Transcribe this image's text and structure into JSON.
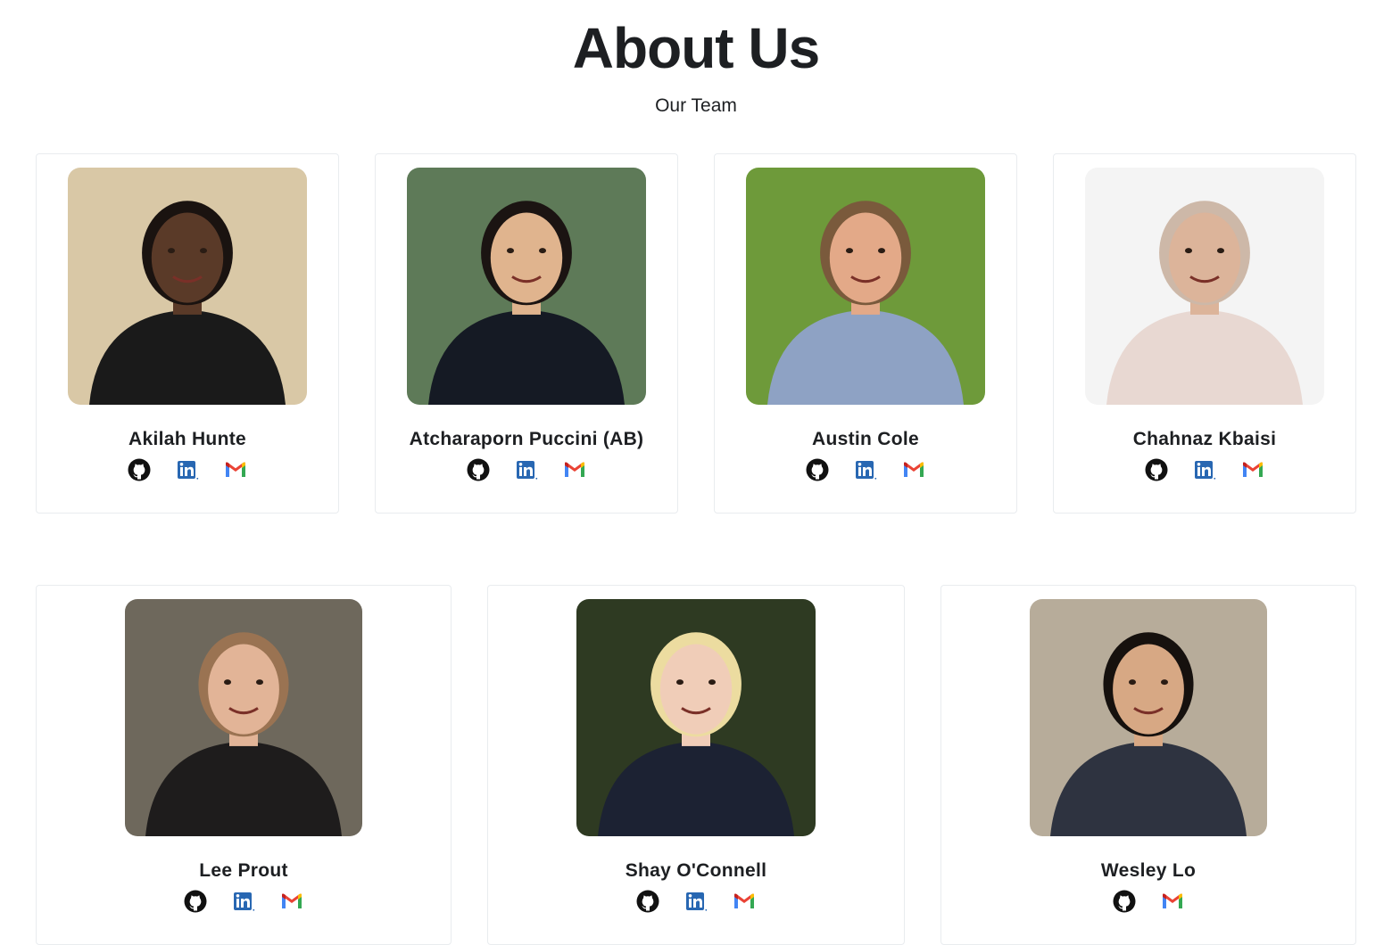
{
  "page": {
    "title": "About Us",
    "subtitle": "Our Team"
  },
  "members": [
    {
      "name": "Akilah Hunte",
      "links": [
        "github-icon",
        "linkedin-icon",
        "gmail-icon"
      ],
      "bg": "#d9c8a6",
      "shirt": "#1a1a1a",
      "skin": "#5a3a28",
      "hair": "#1a1310"
    },
    {
      "name": "Atcharaporn Puccini (AB)",
      "links": [
        "github-icon",
        "linkedin-icon",
        "gmail-icon"
      ],
      "bg": "#5e7a58",
      "shirt": "#151a24",
      "skin": "#e0b48e",
      "hair": "#1b1412"
    },
    {
      "name": "Austin Cole",
      "links": [
        "github-icon",
        "linkedin-icon",
        "gmail-icon"
      ],
      "bg": "#6e9a3a",
      "shirt": "#8ea2c4",
      "skin": "#e3a988",
      "hair": "#7a5a3c"
    },
    {
      "name": "Chahnaz Kbaisi",
      "links": [
        "github-icon",
        "linkedin-icon",
        "gmail-icon"
      ],
      "bg": "#f4f4f4",
      "shirt": "#e8d8d2",
      "skin": "#dcb49a",
      "hair": "#cdb8a8"
    },
    {
      "name": "Lee Prout",
      "links": [
        "github-icon",
        "linkedin-icon",
        "gmail-icon"
      ],
      "bg": "#6e685c",
      "shirt": "#1e1c1c",
      "skin": "#e2b497",
      "hair": "#9a7352"
    },
    {
      "name": "Shay O'Connell",
      "links": [
        "github-icon",
        "linkedin-icon",
        "gmail-icon"
      ],
      "bg": "#2e3a22",
      "shirt": "#1c2233",
      "skin": "#f0cdb8",
      "hair": "#ecdca0"
    },
    {
      "name": "Wesley Lo",
      "links": [
        "github-icon",
        "gmail-icon"
      ],
      "bg": "#b7ac9a",
      "shirt": "#2e3340",
      "skin": "#d7a884",
      "hair": "#16110e"
    }
  ]
}
